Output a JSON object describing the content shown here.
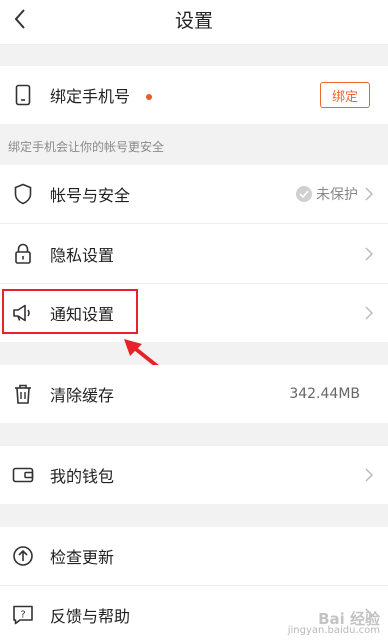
{
  "header": {
    "title": "设置"
  },
  "phone": {
    "label": "绑定手机号",
    "button": "绑定"
  },
  "hint": "绑定手机会让你的帐号更安全",
  "account": {
    "label": "帐号与安全",
    "status": "未保护"
  },
  "privacy": {
    "label": "隐私设置"
  },
  "notify": {
    "label": "通知设置"
  },
  "cache": {
    "label": "清除缓存",
    "size": "342.44MB"
  },
  "wallet": {
    "label": "我的钱包"
  },
  "update": {
    "label": "检查更新"
  },
  "feedback": {
    "label": "反馈与帮助"
  },
  "watermark": {
    "brand": "Bai 经验",
    "url": "jingyan.baidu.com"
  },
  "colors": {
    "accent": "#e86a2a",
    "highlight": "#e8222a",
    "dot": "#f05a24"
  }
}
